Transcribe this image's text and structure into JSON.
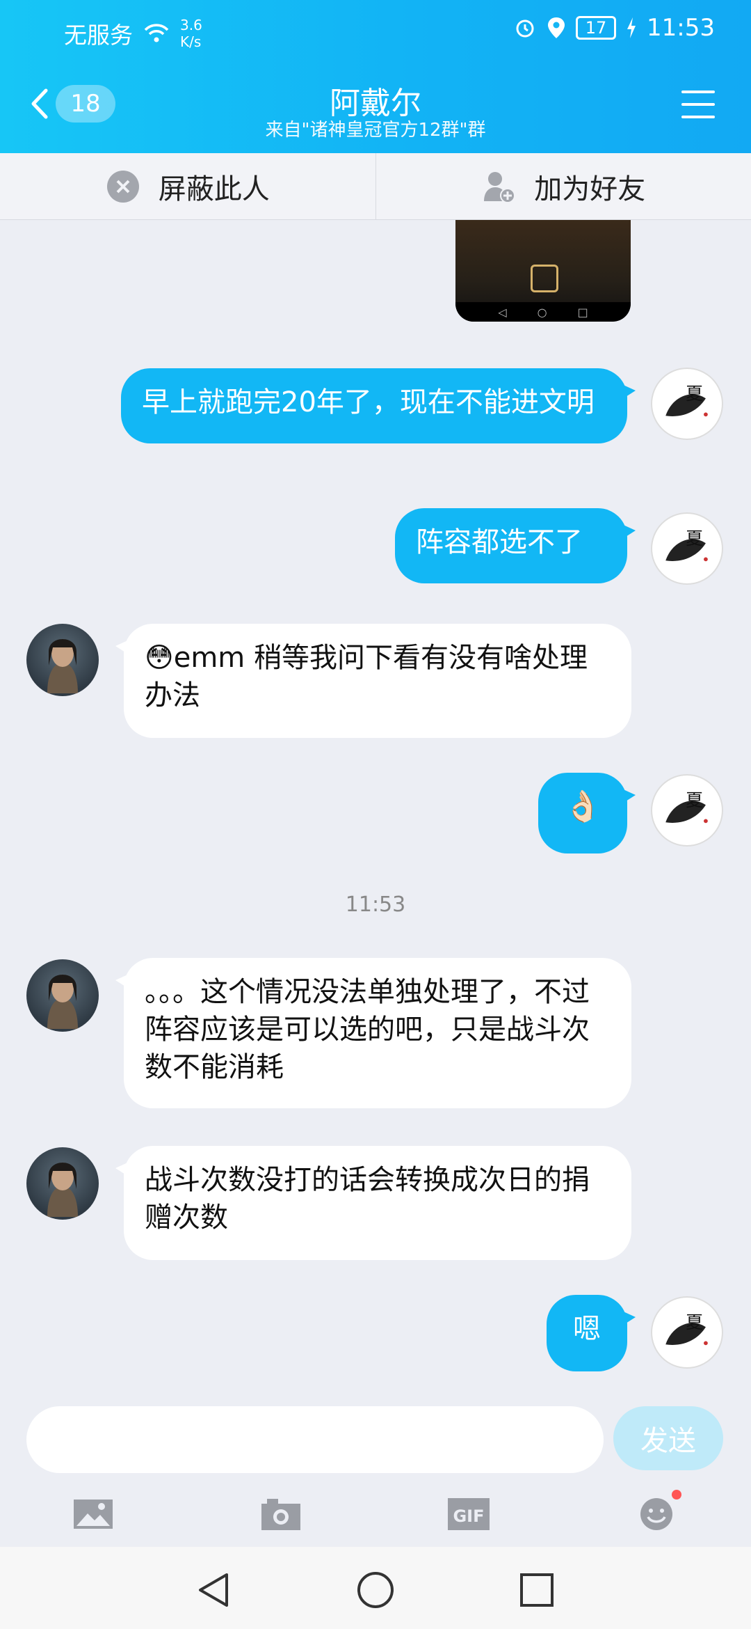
{
  "status_bar": {
    "carrier": "无服务",
    "speed_value": "3.6",
    "speed_unit": "K/s",
    "battery": "17",
    "time": "11:53"
  },
  "header": {
    "back_count": "18",
    "title": "阿戴尔",
    "subtitle": "来自\"诸神皇冠官方12群\"群"
  },
  "actions": {
    "block_label": "屏蔽此人",
    "add_friend_label": "加为好友"
  },
  "messages": [
    {
      "sender": "self",
      "text": "早上就跑完20年了，现在不能进文明"
    },
    {
      "sender": "self",
      "text": "阵容都选不了"
    },
    {
      "sender": "other",
      "emoji": "😳",
      "text": "emm 稍等我问下看有没有啥处理办法"
    },
    {
      "sender": "self",
      "text": "👌🏻"
    },
    {
      "sender": "other",
      "text": "。。。这个情况没法单独处理了，不过阵容应该是可以选的吧，只是战斗次数不能消耗"
    },
    {
      "sender": "other",
      "text": "战斗次数没打的话会转换成次日的捐赠次数"
    },
    {
      "sender": "self",
      "text": "嗯"
    }
  ],
  "timestamp": "11:53",
  "input": {
    "value": "",
    "send_label": "发送"
  },
  "toolbar": {
    "gif_label": "GIF"
  },
  "colors": {
    "accent": "#12b7f5",
    "bubble_other": "#ffffff",
    "background": "#eceef4",
    "send_disabled": "#bfeaf9"
  }
}
